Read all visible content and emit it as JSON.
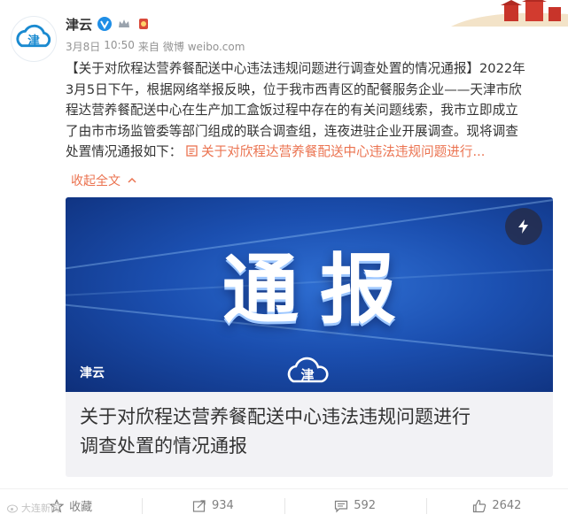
{
  "user": {
    "name": "津云",
    "verified_badge": "verified-v-icon",
    "extra_badges": [
      "crown-icon",
      "medal-icon"
    ]
  },
  "meta": {
    "date": "3月8日",
    "time": "10:50",
    "source_prefix": "来自",
    "source": "微博 weibo.com"
  },
  "post": {
    "lines": [
      "【关于对欣程达营养餐配送中心违法违规问题进行调查处置的情况通报】2022年",
      "3月5日下午，根据网络举报反映，位于我市西青区的配餐服务企业——天津市欣",
      "程达营养餐配送中心在生产加工盒饭过程中存在的有关问题线索，我市立即成立",
      "了由市市场监管委等部门组成的联合调查组，连夜进驻企业开展调查。现将调查"
    ],
    "last_line_prefix": "处置情况通报如下：",
    "link_text": "关于对欣程达营养餐配送中心违法违规问题进行...",
    "collapse_label": "收起全文"
  },
  "card": {
    "image_title": "通报",
    "image_source": "津云",
    "title_lines": [
      "关于对欣程达营养餐配送中心违法违规问题进行",
      "调查处置的情况通报"
    ]
  },
  "footer": {
    "favorite_label": "收藏",
    "repost_count": "934",
    "comment_count": "592",
    "like_count": "2642"
  },
  "watermark": "大连新闻",
  "colors": {
    "link": "#eb7350",
    "card_bg": "#f2f2f5",
    "brand_blue": "#1b4fb0"
  }
}
